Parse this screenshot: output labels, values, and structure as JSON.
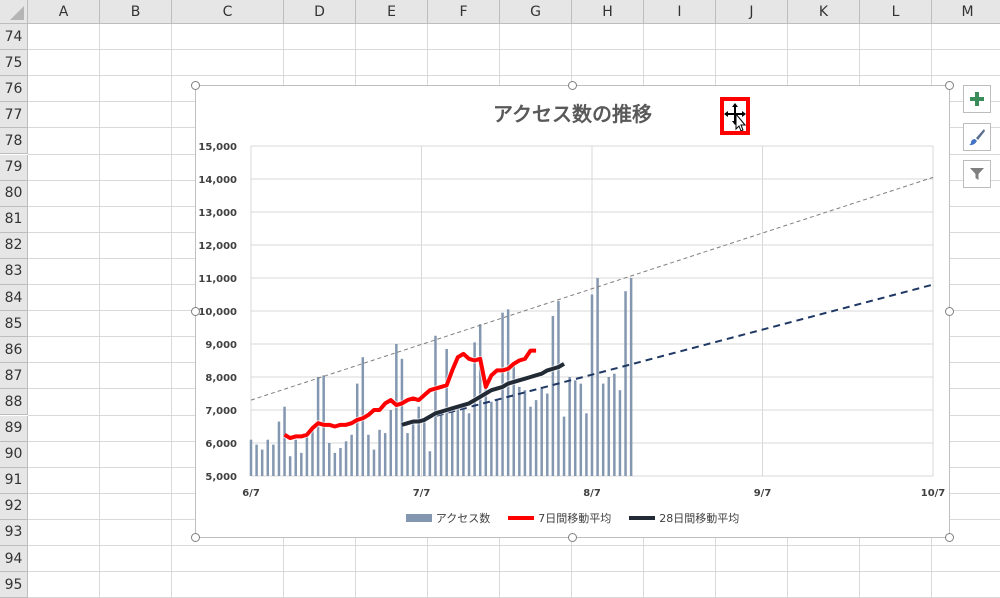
{
  "columns": [
    "A",
    "B",
    "C",
    "D",
    "E",
    "F",
    "G",
    "H",
    "I",
    "J",
    "K",
    "L",
    "M"
  ],
  "rows": [
    "74",
    "75",
    "76",
    "77",
    "78",
    "79",
    "80",
    "81",
    "82",
    "83",
    "84",
    "85",
    "86",
    "87",
    "88",
    "89",
    "90",
    "91",
    "92",
    "93",
    "94",
    "95"
  ],
  "chart": {
    "title": "アクセス数の推移",
    "legend": [
      {
        "label": "アクセス数",
        "color": "#8497b0"
      },
      {
        "label": "7日間移動平均",
        "color": "#ff0000"
      },
      {
        "label": "28日間移動平均",
        "color": "#222a35"
      }
    ]
  },
  "side_buttons": {
    "add": "chart-elements",
    "style": "chart-styles",
    "filter": "chart-filters"
  },
  "chart_data": {
    "type": "bar",
    "title": "アクセス数の推移",
    "y_ticks": [
      "15,000",
      "14,000",
      "13,000",
      "12,000",
      "11,000",
      "10,000",
      "9,000",
      "8,000",
      "7,000",
      "6,000",
      "5,000"
    ],
    "x_ticks": [
      "6/7",
      "7/7",
      "8/7",
      "9/7",
      "10/7"
    ],
    "ylim": [
      5000,
      15000
    ],
    "x_range_days": [
      0,
      122
    ],
    "grid": true,
    "legend_position": "bottom",
    "series": [
      {
        "name": "アクセス数",
        "type": "bar",
        "color": "#8497b0",
        "values": [
          6100,
          5950,
          5800,
          6100,
          5950,
          6650,
          7100,
          5600,
          6100,
          5700,
          6250,
          6500,
          8000,
          8050,
          6000,
          5700,
          5850,
          6050,
          6250,
          7800,
          8600,
          6250,
          5800,
          6400,
          6300,
          7000,
          9000,
          8550,
          6300,
          6650,
          7100,
          6650,
          5750,
          9250,
          7000,
          8850,
          7000,
          7150,
          7150,
          6900,
          9050,
          9600,
          7800,
          7250,
          7300,
          9950,
          10050,
          8400,
          7700,
          7600,
          7100,
          7300,
          7700,
          7500,
          9850,
          10300,
          6800,
          8000,
          7900,
          7800,
          6900,
          10500,
          11000,
          7800,
          8000,
          8100,
          7600,
          10600,
          11000
        ]
      },
      {
        "name": "7日間移動平均",
        "type": "line",
        "color": "#ff0000",
        "start_day": 6,
        "values": [
          6250,
          6150,
          6200,
          6200,
          6250,
          6450,
          6600,
          6550,
          6550,
          6500,
          6550,
          6550,
          6600,
          6700,
          6750,
          6850,
          7000,
          7000,
          7200,
          7300,
          7150,
          7200,
          7300,
          7350,
          7300,
          7450,
          7600,
          7650,
          7700,
          7750,
          8200,
          8600,
          8700,
          8550,
          8500,
          8550,
          7700,
          8050,
          8200,
          8200,
          8250,
          8400,
          8500,
          8550,
          8800,
          8800
        ]
      },
      {
        "name": "28日間移動平均",
        "type": "line",
        "color": "#222a35",
        "start_day": 27,
        "values": [
          6550,
          6600,
          6650,
          6650,
          6700,
          6800,
          6900,
          6950,
          7000,
          7050,
          7100,
          7150,
          7200,
          7300,
          7400,
          7500,
          7600,
          7650,
          7700,
          7800,
          7850,
          7900,
          7950,
          8000,
          8050,
          8100,
          8200,
          8250,
          8300,
          8400
        ]
      },
      {
        "name": "trend-access",
        "type": "trendline",
        "color": "#7f7f7f",
        "x": [
          0,
          122
        ],
        "values": [
          7300,
          14050
        ]
      },
      {
        "name": "trend-28day",
        "type": "trendline",
        "color": "#1f3864",
        "x": [
          27,
          122
        ],
        "values": [
          6550,
          10800
        ]
      }
    ]
  }
}
